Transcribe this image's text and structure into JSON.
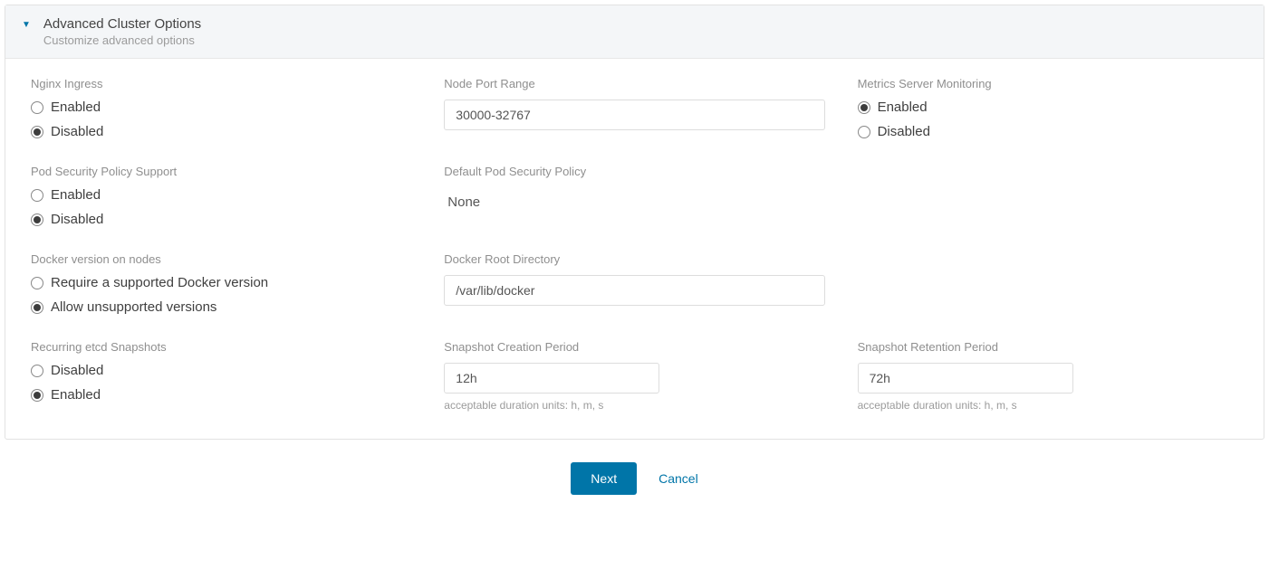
{
  "header": {
    "title": "Advanced Cluster Options",
    "subtitle": "Customize advanced options"
  },
  "nginx_ingress": {
    "label": "Nginx Ingress",
    "options": {
      "enabled": "Enabled",
      "disabled": "Disabled"
    },
    "selected": "disabled"
  },
  "node_port_range": {
    "label": "Node Port Range",
    "value": "30000-32767"
  },
  "metrics_server": {
    "label": "Metrics Server Monitoring",
    "options": {
      "enabled": "Enabled",
      "disabled": "Disabled"
    },
    "selected": "enabled"
  },
  "pod_security_policy_support": {
    "label": "Pod Security Policy Support",
    "options": {
      "enabled": "Enabled",
      "disabled": "Disabled"
    },
    "selected": "disabled"
  },
  "default_pod_security_policy": {
    "label": "Default Pod Security Policy",
    "value": "None"
  },
  "docker_version": {
    "label": "Docker version on nodes",
    "options": {
      "require": "Require a supported Docker version",
      "allow": "Allow unsupported versions"
    },
    "selected": "allow"
  },
  "docker_root_dir": {
    "label": "Docker Root Directory",
    "value": "/var/lib/docker"
  },
  "etcd_snapshots": {
    "label": "Recurring etcd Snapshots",
    "options": {
      "disabled": "Disabled",
      "enabled": "Enabled"
    },
    "selected": "enabled"
  },
  "snapshot_creation": {
    "label": "Snapshot Creation Period",
    "value": "12h",
    "help": "acceptable duration units: h, m, s"
  },
  "snapshot_retention": {
    "label": "Snapshot Retention Period",
    "value": "72h",
    "help": "acceptable duration units: h, m, s"
  },
  "footer": {
    "next": "Next",
    "cancel": "Cancel"
  }
}
